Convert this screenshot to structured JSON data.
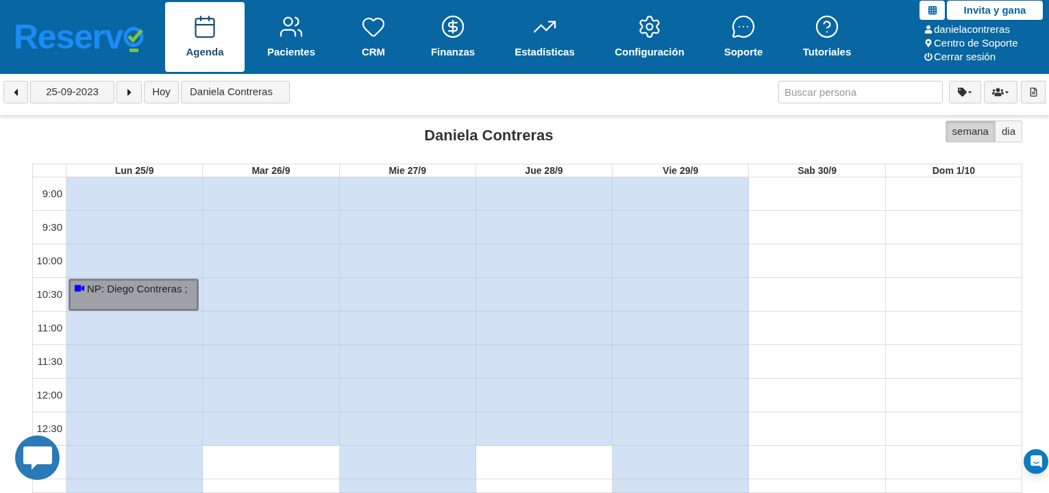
{
  "header": {
    "logo": "Reserv",
    "nav": [
      {
        "label": "Agenda",
        "selected": true
      },
      {
        "label": "Pacientes",
        "selected": false
      },
      {
        "label": "CRM",
        "selected": false
      },
      {
        "label": "Finanzas",
        "selected": false
      },
      {
        "label": "Estadísticas",
        "selected": false
      },
      {
        "label": "Configuración",
        "selected": false
      },
      {
        "label": "Soporte",
        "selected": false
      },
      {
        "label": "Tutoriales",
        "selected": false
      }
    ],
    "invite_button": "Invita y gana",
    "user_links": [
      {
        "label": "danielacontreras"
      },
      {
        "label": "Centro de Soporte"
      },
      {
        "label": "Cerrar sesión"
      }
    ]
  },
  "toolbar": {
    "date": "25-09-2023",
    "today_button": "Hoy",
    "professional": "Daniela Contreras",
    "search": {
      "placeholder": "Buscar persona"
    }
  },
  "calendar": {
    "title": "Daniela Contreras",
    "views": [
      {
        "label": "semana",
        "selected": true
      },
      {
        "label": "dia",
        "selected": false
      }
    ],
    "times": [
      "9:00",
      "9:30",
      "10:00",
      "10:30",
      "11:00",
      "11:30",
      "12:00",
      "12:30"
    ],
    "days": [
      {
        "label": "Lun 25/9",
        "slots": [
          {
            "available": true
          },
          {
            "available": true
          },
          {
            "available": true
          },
          {
            "available": true,
            "event": {
              "kind": "video",
              "text": "NP: Diego Contreras ;"
            }
          },
          {
            "available": true
          },
          {
            "available": true
          },
          {
            "available": true
          },
          {
            "available": true
          },
          {
            "available": true
          },
          {
            "available": true
          }
        ]
      },
      {
        "label": "Mar 26/9",
        "slots": [
          {
            "available": true
          },
          {
            "available": true
          },
          {
            "available": true
          },
          {
            "available": true
          },
          {
            "available": true
          },
          {
            "available": true
          },
          {
            "available": true
          },
          {
            "available": true
          },
          {
            "available": false
          },
          {
            "available": false
          }
        ]
      },
      {
        "label": "Mie 27/9",
        "slots": [
          {
            "available": true
          },
          {
            "available": true
          },
          {
            "available": true
          },
          {
            "available": true
          },
          {
            "available": true
          },
          {
            "available": true
          },
          {
            "available": true
          },
          {
            "available": true
          },
          {
            "available": true
          },
          {
            "available": true
          }
        ]
      },
      {
        "label": "Jue 28/9",
        "slots": [
          {
            "available": true
          },
          {
            "available": true
          },
          {
            "available": true
          },
          {
            "available": true
          },
          {
            "available": true
          },
          {
            "available": true
          },
          {
            "available": true
          },
          {
            "available": true
          },
          {
            "available": false
          },
          {
            "available": false
          }
        ]
      },
      {
        "label": "Vie 29/9",
        "slots": [
          {
            "available": true
          },
          {
            "available": true
          },
          {
            "available": true
          },
          {
            "available": true
          },
          {
            "available": true
          },
          {
            "available": true
          },
          {
            "available": true
          },
          {
            "available": true
          },
          {
            "available": true
          },
          {
            "available": true
          }
        ]
      },
      {
        "label": "Sab 30/9",
        "slots": [
          {
            "available": false
          },
          {
            "available": false
          },
          {
            "available": false
          },
          {
            "available": false
          },
          {
            "available": false
          },
          {
            "available": false
          },
          {
            "available": false
          },
          {
            "available": false
          },
          {
            "available": false
          },
          {
            "available": false
          }
        ]
      },
      {
        "label": "Dom 1/10",
        "slots": [
          {
            "available": false
          },
          {
            "available": false
          },
          {
            "available": false
          },
          {
            "available": false
          },
          {
            "available": false
          },
          {
            "available": false
          },
          {
            "available": false
          },
          {
            "available": false
          },
          {
            "available": false
          },
          {
            "available": false
          }
        ]
      }
    ]
  }
}
